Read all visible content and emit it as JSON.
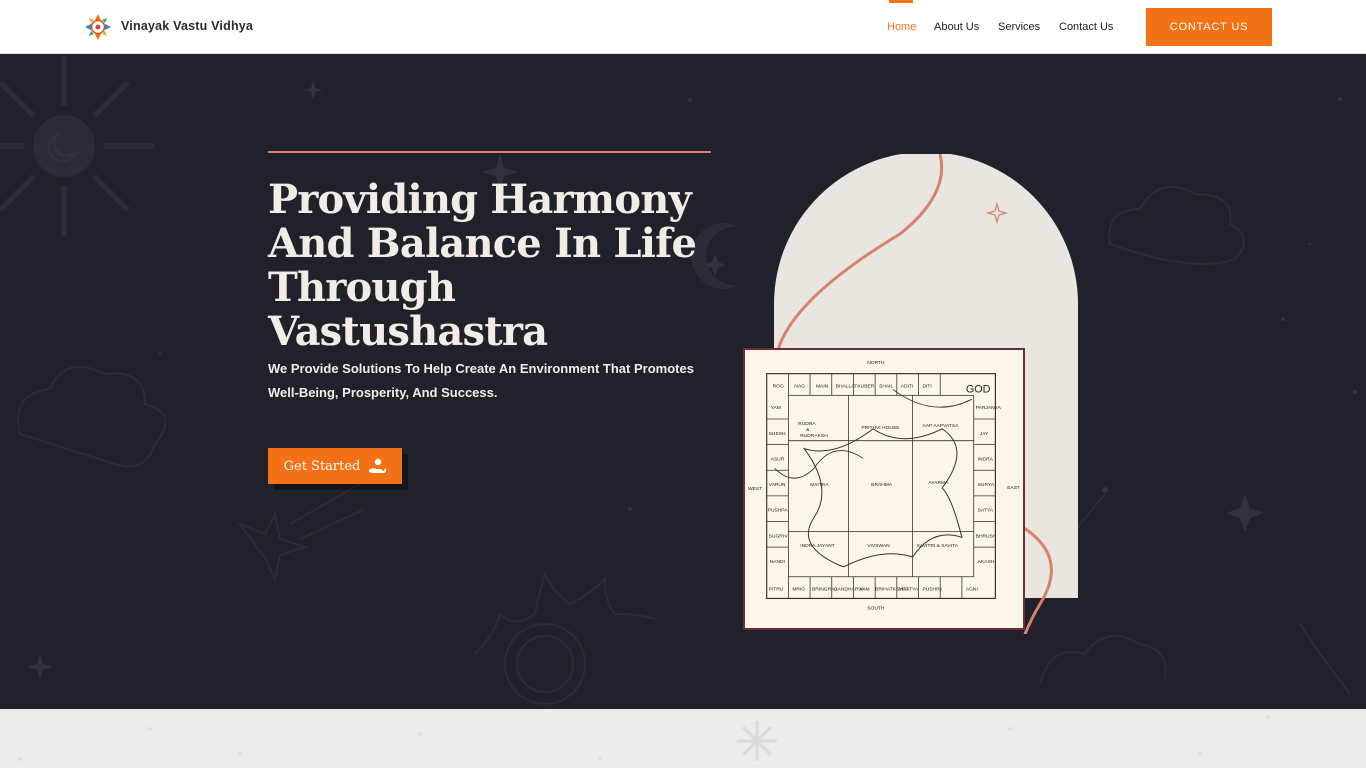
{
  "header": {
    "brand": "Vinayak Vastu Vidhya",
    "nav": [
      {
        "label": "Home",
        "active": true
      },
      {
        "label": "About Us",
        "active": false
      },
      {
        "label": "Services",
        "active": false
      },
      {
        "label": "Contact Us",
        "active": false
      }
    ],
    "cta_label": "CONTACT US"
  },
  "hero": {
    "title_lines": [
      "Providing Harmony",
      "And Balance In Life",
      "Through Vastushastra"
    ],
    "subtitle_lines": [
      "We Provide Solutions To Help Create An Environment That Promotes",
      "Well-Being, Prosperity, And Success."
    ],
    "button_label": "Get Started",
    "button_icon": "hand-user-icon"
  },
  "vastu_grid": {
    "north": "NORTH",
    "south": "SOUTH",
    "east": "EAST",
    "west": "WEST",
    "god": "GOD",
    "top_row": [
      "ROG",
      "NAG",
      "MAIN",
      "BHALLAT",
      "KUBER",
      "SHAIL",
      "ADITI",
      "DITI"
    ],
    "bottom_row": [
      "PITRU",
      "MRIG",
      "BRINGRAJ",
      "GANDHARVA",
      "YAM",
      "BRIHATKSHAT",
      "VITATYA",
      "PUSHPA",
      "AGNI"
    ],
    "left_col": [
      "YAM",
      "SHESH",
      "ASUR",
      "VARUN",
      "PUSHPA",
      "SUGRIV",
      "NANDI"
    ],
    "right_col": [
      "PARJANYA",
      "JAY",
      "INDRA",
      "SURYA",
      "SATYA",
      "BHRUSH",
      "AKASH"
    ],
    "inner": [
      "RUDRA",
      "&",
      "RUDRAKSH",
      "PRITHVI HOUSE",
      "AAP AAPVATSA",
      "MAITRA",
      "BRAHMA",
      "AYARMA",
      "INDRA JAYANT",
      "VIVSWAN",
      "SAVITRI & SAVITA"
    ]
  },
  "colors": {
    "accent": "#f47216",
    "hero_bg": "#21212b",
    "hero_text": "#f1ede6",
    "arch": "#e9e6e1",
    "curve": "#d9826b"
  }
}
